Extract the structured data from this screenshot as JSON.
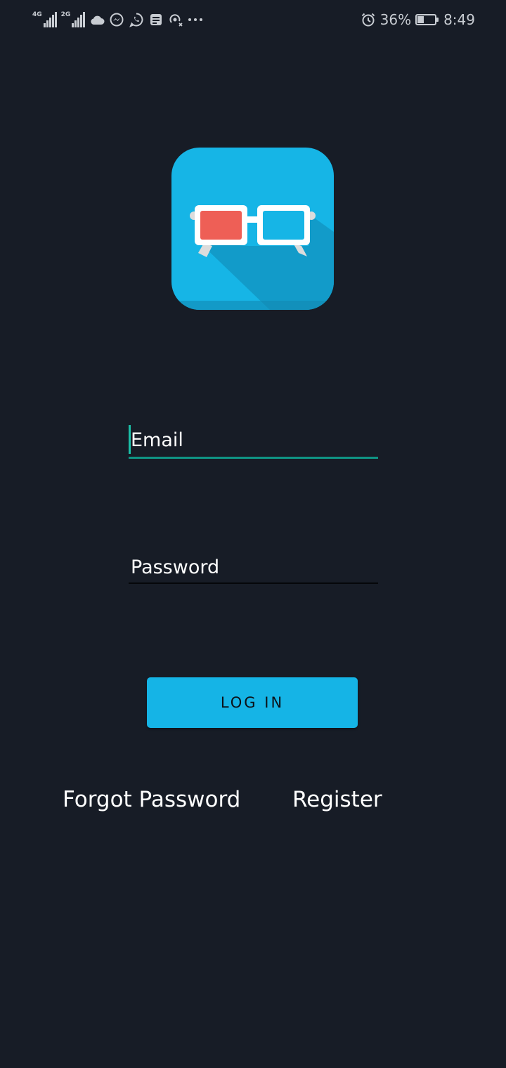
{
  "status_bar": {
    "network_1": "4G",
    "network_2": "2G",
    "icons": [
      "signal-4g-icon",
      "signal-2g-icon",
      "cloud-icon",
      "messenger-icon",
      "whatsapp-icon",
      "news-icon",
      "hotspot-icon",
      "more-dots-icon"
    ],
    "battery_percent": "36%",
    "battery_level": 0.36,
    "time": "8:49",
    "color": "#c8ccd2"
  },
  "logo": {
    "icon": "3d-glasses-icon",
    "background_color": "#16b5e6",
    "left_lens_color": "#ee5f56",
    "right_lens_color": "#16b5e6"
  },
  "form": {
    "email_placeholder": "Email",
    "password_placeholder": "Password",
    "accent_color": "#0f9484"
  },
  "login_button": {
    "label": "LOG IN",
    "color": "#15b4e6"
  },
  "links": {
    "forgot_password": "Forgot Password",
    "register": "Register"
  },
  "background_color": "#171c26"
}
